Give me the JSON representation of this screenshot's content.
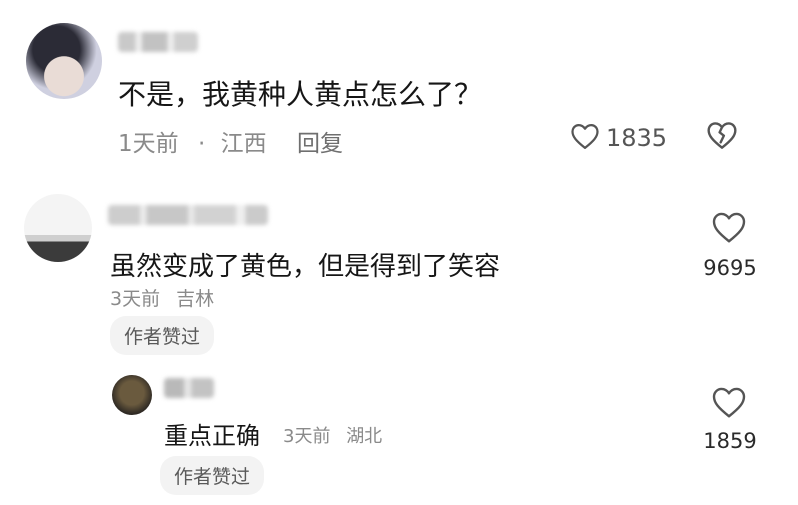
{
  "comments": [
    {
      "text": "不是，我黄种人黄点怎么了？",
      "time": "1天前",
      "separator": "·",
      "location": "江西",
      "reply_label": "回复",
      "like_count": "1835"
    },
    {
      "text": "虽然变成了黄色，但是得到了笑容",
      "time": "3天前",
      "location": "吉林",
      "author_badge": "作者赞过",
      "like_count": "9695",
      "replies": [
        {
          "text": "重点正确",
          "time": "3天前",
          "location": "湖北",
          "author_badge": "作者赞过",
          "like_count": "1859"
        }
      ]
    }
  ],
  "icons": {
    "like": "heart-outline-icon",
    "dislike": "broken-heart-icon"
  }
}
